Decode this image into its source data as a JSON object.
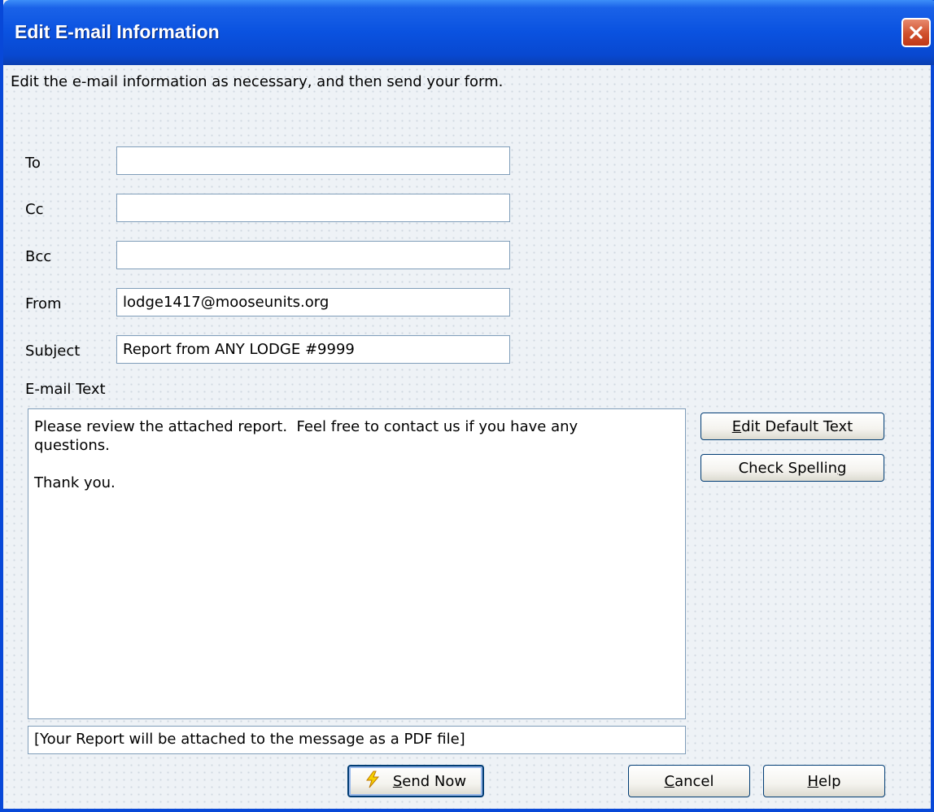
{
  "window": {
    "title": "Edit E-mail Information",
    "close_icon": "close-icon"
  },
  "instructions": "Edit the e-mail information as necessary, and then send your form.",
  "fields": {
    "to": {
      "label": "To",
      "value": ""
    },
    "cc": {
      "label": "Cc",
      "value": ""
    },
    "bcc": {
      "label": "Bcc",
      "value": ""
    },
    "from": {
      "label": "From",
      "value": "lodge1417@mooseunits.org"
    },
    "subject": {
      "label": "Subject",
      "value": "Report from ANY LODGE #9999"
    }
  },
  "email_text": {
    "label": "E-mail Text",
    "value": "Please review the attached report.  Feel free to contact us if you have any\nquestions.\n\nThank you."
  },
  "attachment_note": "[Your Report will be attached to the message as a PDF file]",
  "buttons": {
    "edit_default_text": {
      "mnemonic": "E",
      "rest": "dit Default Text"
    },
    "check_spelling": {
      "prefix": "Check Spellin",
      "mnemonic": "g"
    },
    "send_now": {
      "mnemonic": "S",
      "rest": "end Now",
      "icon": "lightning-icon"
    },
    "cancel": {
      "mnemonic": "C",
      "rest": "ancel"
    },
    "help": {
      "mnemonic": "H",
      "rest": "elp"
    }
  },
  "colors": {
    "titlebar": "#0a52e0",
    "close_button": "#d0502c",
    "send_icon": "#f5d000"
  }
}
